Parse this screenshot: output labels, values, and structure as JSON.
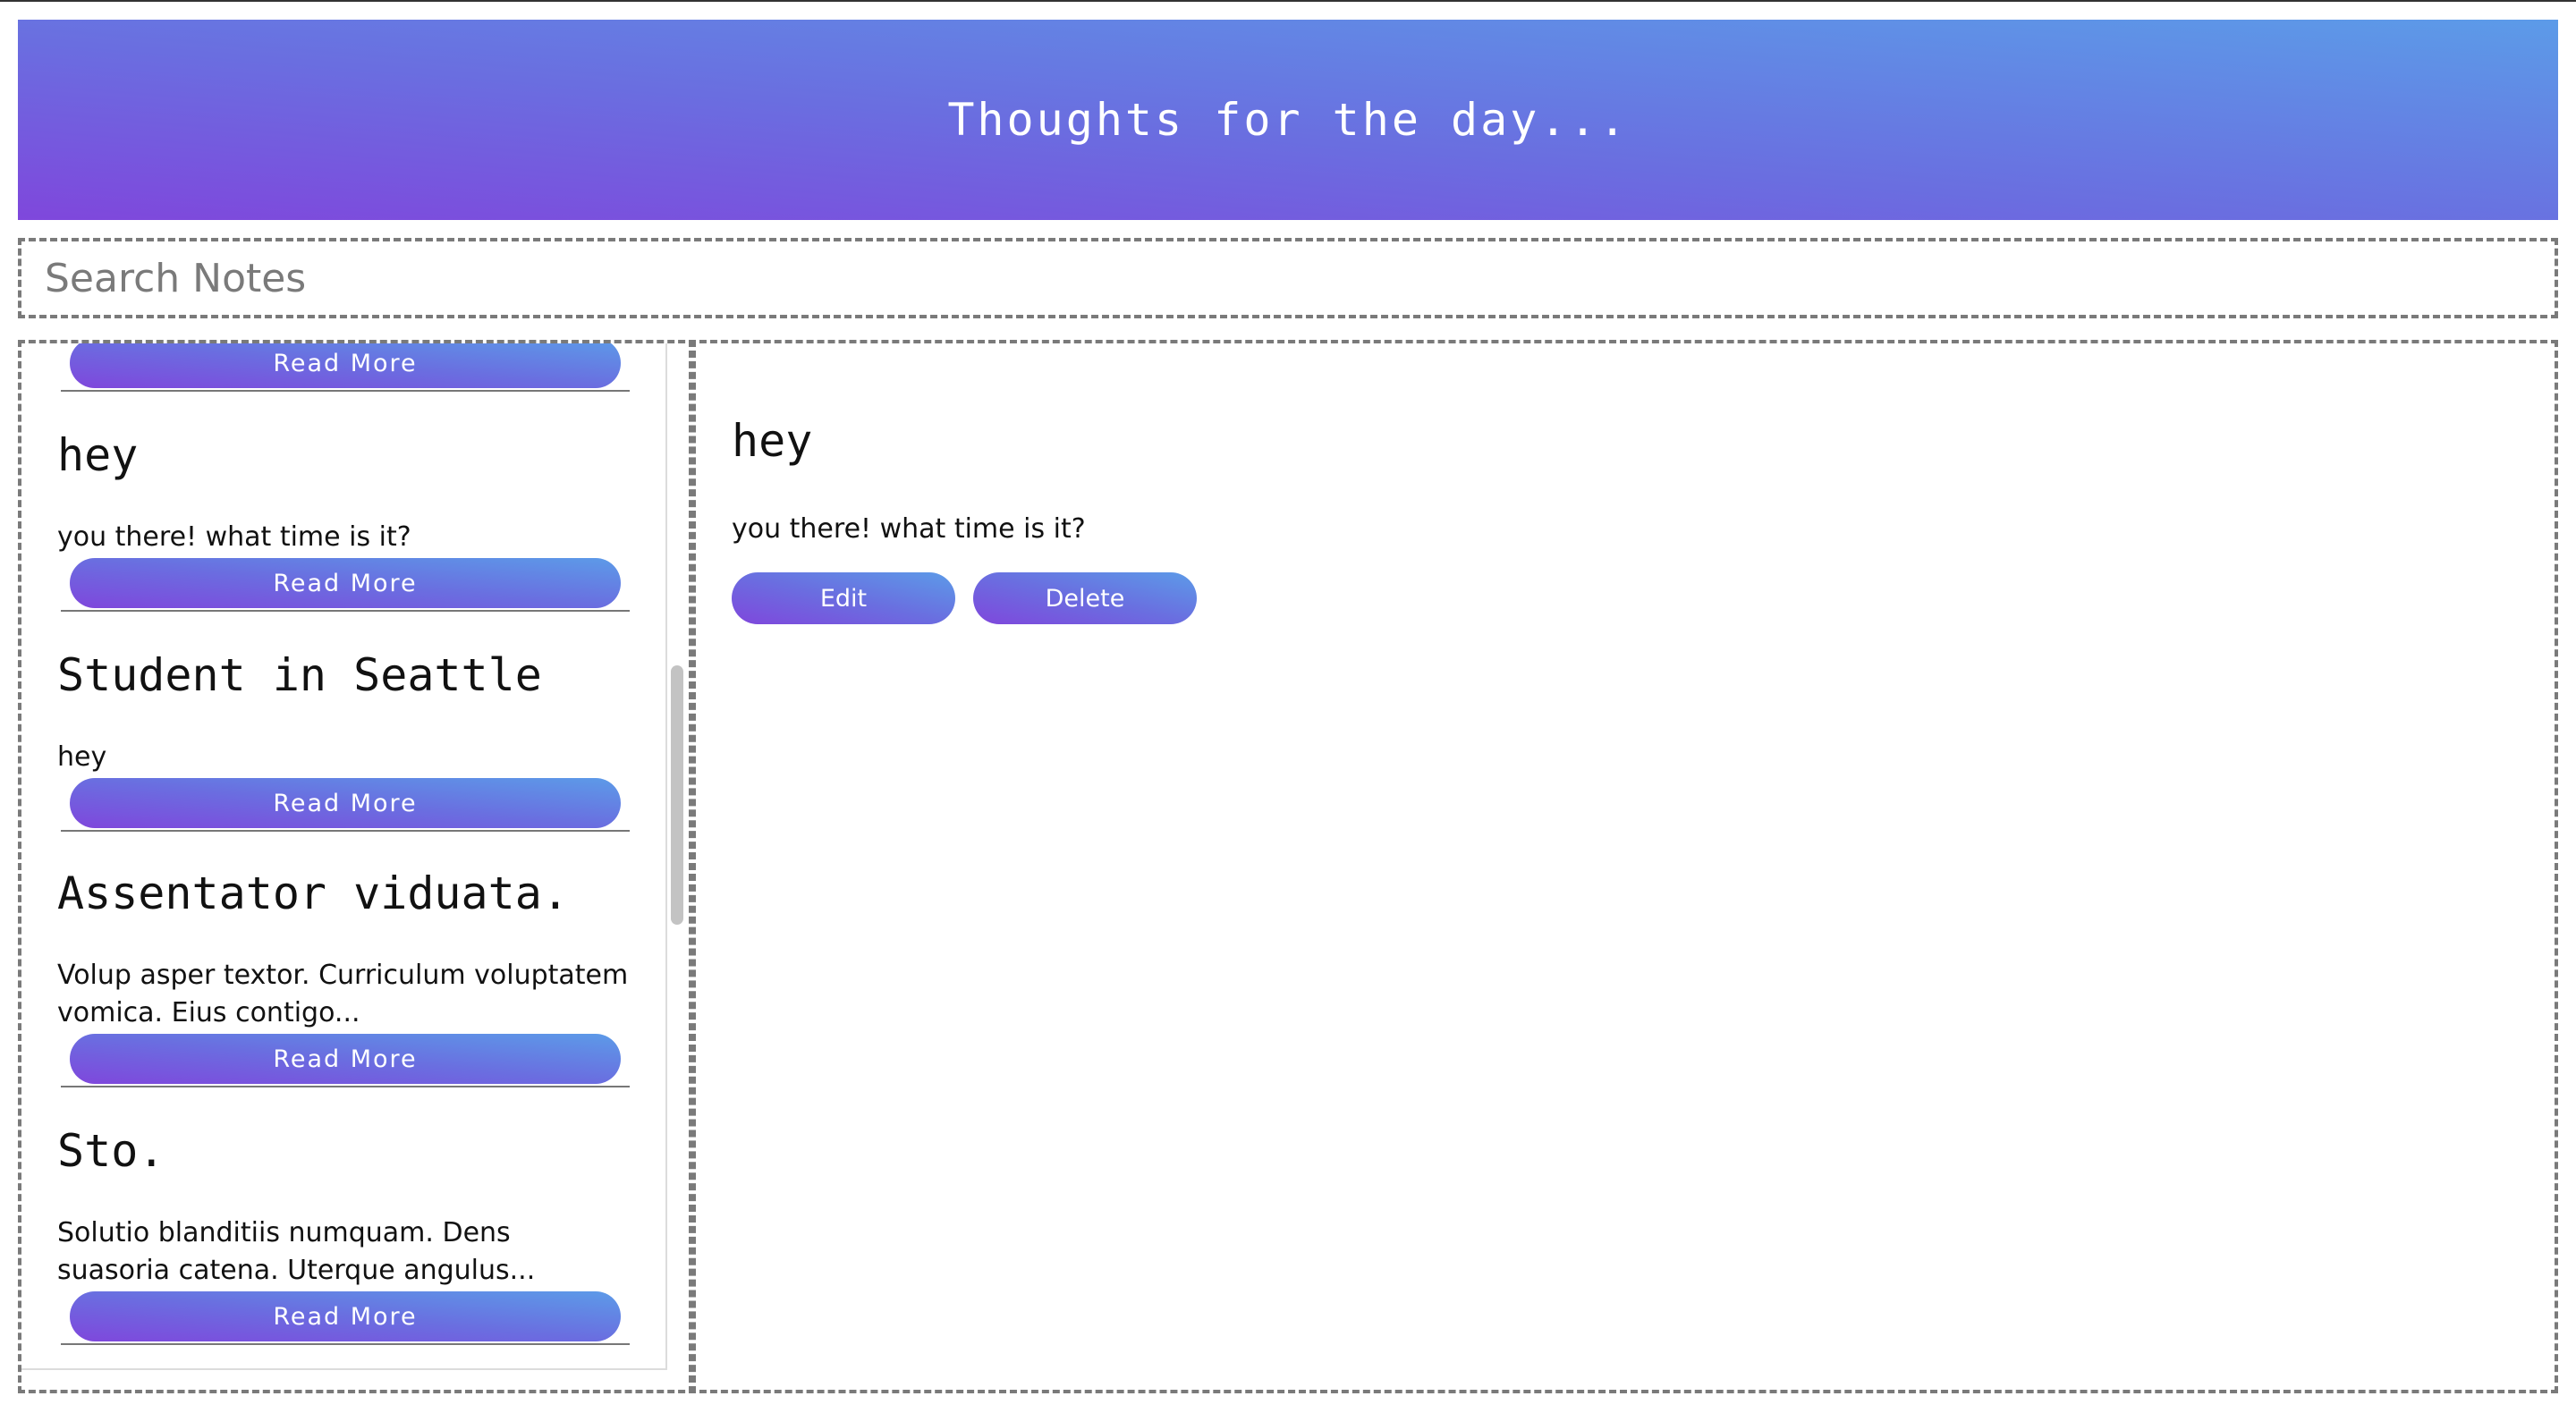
{
  "header": {
    "title": "Thoughts for the day..."
  },
  "search": {
    "placeholder": "Search Notes",
    "value": ""
  },
  "notes": [
    {
      "title": "",
      "body": "",
      "button": "Read More"
    },
    {
      "title": "hey",
      "body": "you there! what time is it?",
      "button": "Read More"
    },
    {
      "title": "Student in Seattle",
      "body": "hey",
      "button": "Read More"
    },
    {
      "title": "Assentator viduata.",
      "body": "Volup asper textor. Curriculum voluptatem vomica.  Eius contigo...",
      "button": "Read More"
    },
    {
      "title": "Sto.",
      "body": "Solutio blanditiis numquam.  Dens suasoria catena. Uterque angulus...",
      "button": "Read More"
    }
  ],
  "detail": {
    "title": "hey",
    "body": "you there! what time is it?",
    "edit_label": "Edit",
    "delete_label": "Delete"
  },
  "colors": {
    "accent_start": "#7f47dc",
    "accent_end": "#5c9be8"
  }
}
